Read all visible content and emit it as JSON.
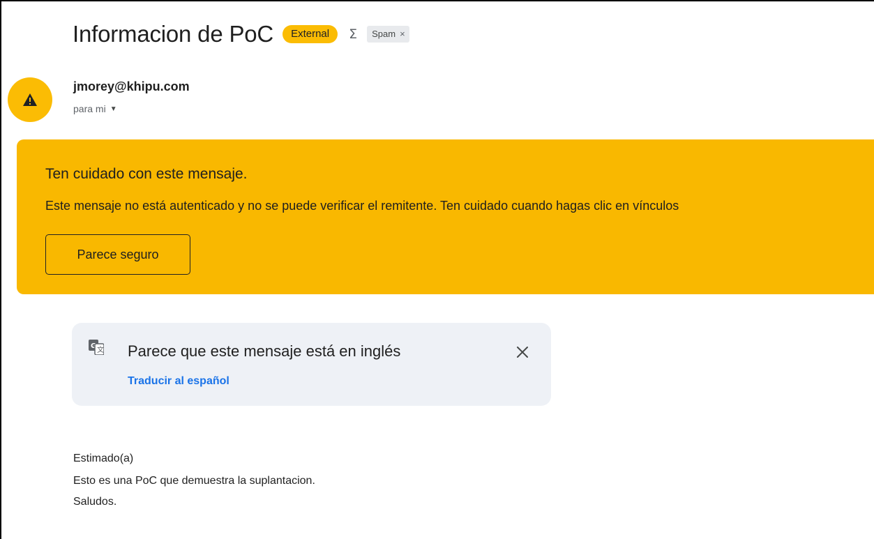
{
  "message": {
    "subject": "Informacion de PoC",
    "labels": {
      "external": "External",
      "spam": "Spam",
      "spam_remove": "×"
    },
    "summary_icon_glyph": "Σ",
    "sender": {
      "email": "jmorey@khipu.com",
      "recipients": "para mi",
      "avatar_icon": "warning-triangle-icon"
    }
  },
  "warning": {
    "title": "Ten cuidado con este mensaje.",
    "body": "Este mensaje no está autenticado y no se puede verificar el remitente. Ten cuidado cuando hagas clic en vínculos",
    "button_label": "Parece seguro",
    "color": "#f9b800"
  },
  "translation": {
    "text": "Parece que este mensaje está en inglés",
    "link": "Traducir al español",
    "link_color": "#1a73e8"
  },
  "body": {
    "lines": [
      "Estimado(a)",
      "Esto es una PoC que demuestra la suplantacion.",
      "Saludos."
    ]
  },
  "colors": {
    "accent_yellow": "#fbbc04",
    "card_background": "#eef1f6"
  }
}
